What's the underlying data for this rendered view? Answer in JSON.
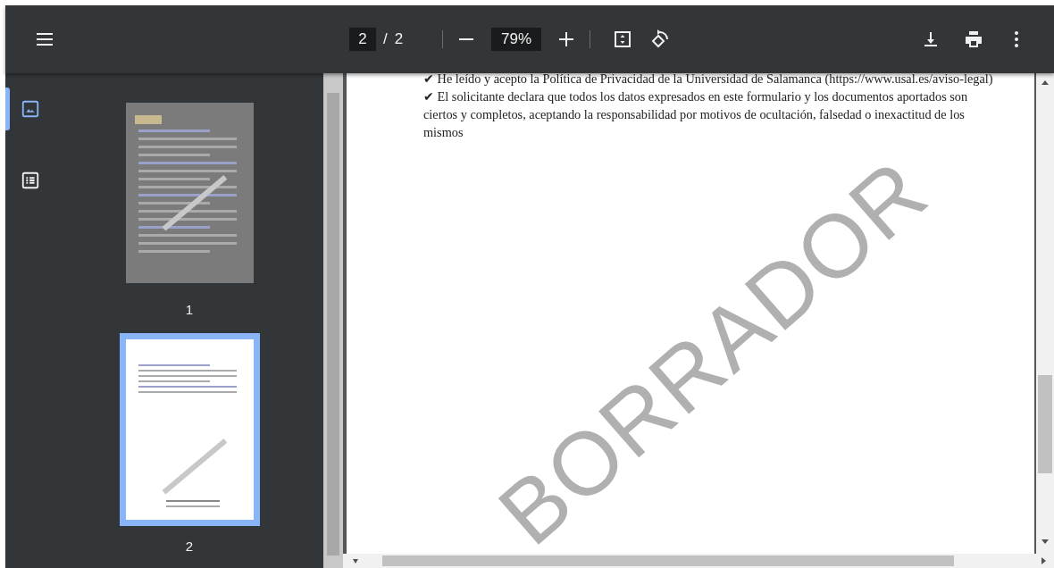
{
  "toolbar": {
    "page_current": "2",
    "page_separator": "/",
    "page_total": "2",
    "zoom": "79%"
  },
  "sidebar": {
    "views": [
      {
        "kind": "thumbnails",
        "selected": true
      },
      {
        "kind": "outline",
        "selected": false
      }
    ],
    "thumbnails": [
      {
        "label": "1",
        "selected": false
      },
      {
        "label": "2",
        "selected": true
      }
    ]
  },
  "document": {
    "paragraphs": [
      "✔ He leído y acepto la Política de Privacidad de la Universidad de Salamanca (https://www.usal.es/aviso-legal)",
      "✔ El solicitante declara que todos los datos expresados en este formulario y los documentos aportados son ciertos y completos, aceptando la responsabilidad por motivos de ocultación, falsedad o inexactitud de los mismos"
    ],
    "stamp": "BORRADOR"
  }
}
